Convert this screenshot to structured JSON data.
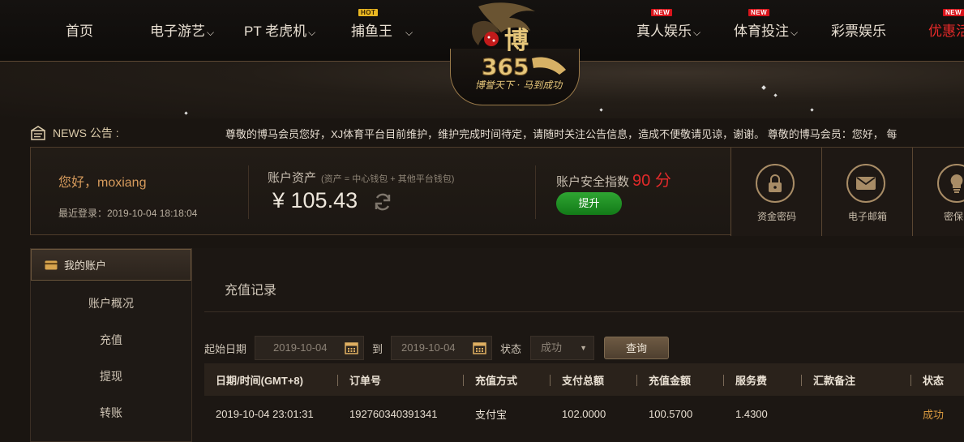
{
  "nav": {
    "left": [
      {
        "label": "首页",
        "chevron": false
      },
      {
        "label": "电子游艺",
        "chevron": true
      },
      {
        "label": "PT 老虎机",
        "chevron": true
      },
      {
        "label": "捕鱼王",
        "chevron": true,
        "badge": "HOT"
      }
    ],
    "right": [
      {
        "label": "真人娱乐",
        "chevron": true,
        "badge": "NEW"
      },
      {
        "label": "体育投注",
        "chevron": true,
        "badge": "NEW"
      },
      {
        "label": "彩票娱乐",
        "chevron": false
      },
      {
        "label": "优惠活",
        "chevron": false,
        "badge": "NEW"
      }
    ],
    "chevron_glyph": "⌵"
  },
  "logo": {
    "mark_text": "博",
    "number": "365",
    "slogan": "博誉天下 · 马到成功"
  },
  "news": {
    "label": "NEWS 公告 :",
    "text": "尊敬的博马会员您好，XJ体育平台目前维护，维护完成时间待定，请随时关注公告信息，造成不便敬请见谅，谢谢。      尊敬的博马会员：您好， 每"
  },
  "account": {
    "greeting": "您好，moxiang",
    "last_login": "最近登录：2019-10-04 18:18:04",
    "asset_title": "账户资产",
    "asset_note": "(资产 = 中心钱包 + 其他平台钱包)",
    "balance": "¥ 105.43",
    "security_title": "账户安全指数",
    "security_score": "90 分",
    "upgrade_label": "提升",
    "tools": [
      {
        "icon": "lock-icon",
        "label": "资金密码"
      },
      {
        "icon": "mail-icon",
        "label": "电子邮箱"
      },
      {
        "icon": "bulb-icon",
        "label": "密保问"
      }
    ]
  },
  "sidebar": {
    "header": "我的账户",
    "items": [
      "账户概况",
      "充值",
      "提现",
      "转账"
    ]
  },
  "main": {
    "title": "充值记录",
    "filter": {
      "start_label": "起始日期",
      "start_value": "2019-10-04",
      "to_label": "到",
      "end_value": "2019-10-04",
      "status_label": "状态",
      "status_value": "成功",
      "query_label": "查询"
    },
    "table": {
      "headers": [
        "日期/时间(GMT+8)",
        "订单号",
        "充值方式",
        "支付总额",
        "充值金额",
        "服务费",
        "汇款备注",
        "状态"
      ],
      "rows": [
        [
          "2019-10-04 23:01:31",
          "192760340391341",
          "支付宝",
          "102.0000",
          "100.5700",
          "1.4300",
          "",
          "成功"
        ]
      ]
    }
  },
  "colors": {
    "accent_gold": "#d99a3f",
    "score_red": "#e12a2a",
    "upgrade_green": "#2fa532"
  }
}
